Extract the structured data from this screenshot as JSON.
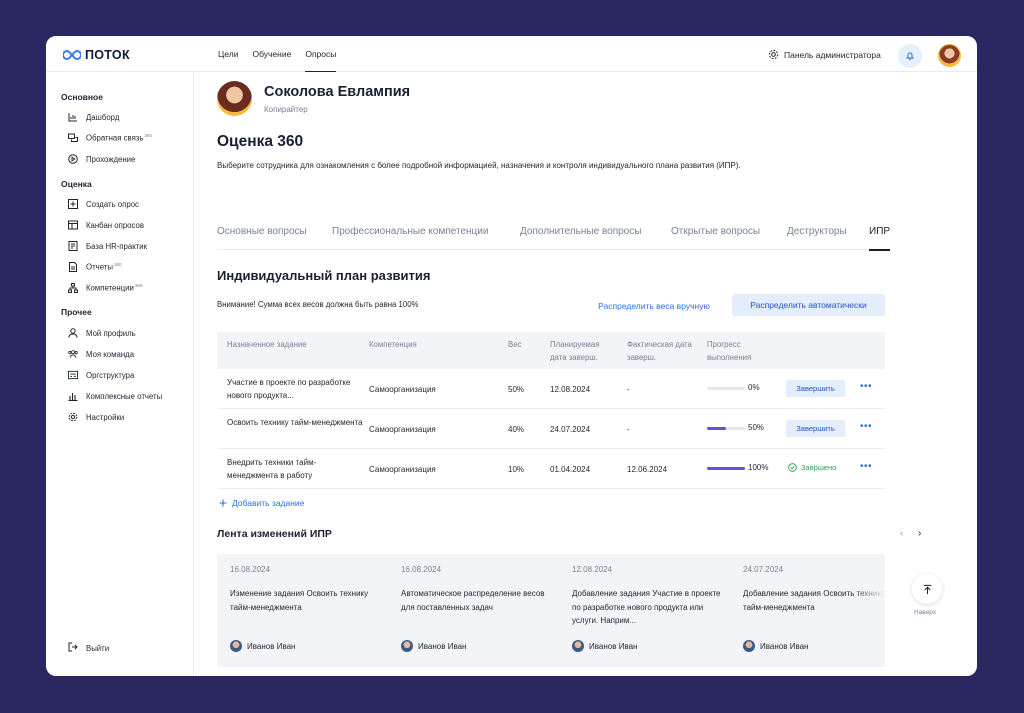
{
  "app": {
    "logo_text": "ПОТОК"
  },
  "topnav": {
    "items": [
      "Цели",
      "Обучение",
      "Опросы"
    ],
    "active": "Опросы"
  },
  "header": {
    "admin_label": "Панель администратора"
  },
  "sidebar": {
    "sections": [
      {
        "title": "Основное",
        "items": [
          {
            "label": "Дашборд",
            "badge": "",
            "icon": "chart-icon"
          },
          {
            "label": "Обратная связь",
            "badge": "360",
            "icon": "chat-icon"
          },
          {
            "label": "Прохождение",
            "badge": "",
            "icon": "play-icon"
          }
        ]
      },
      {
        "title": "Оценка",
        "items": [
          {
            "label": "Создать опрос",
            "badge": "",
            "icon": "plus-square-icon"
          },
          {
            "label": "Канбан опросов",
            "badge": "",
            "icon": "kanban-icon"
          },
          {
            "label": "База HR-практик",
            "badge": "",
            "icon": "book-icon"
          },
          {
            "label": "Отчеты",
            "badge": "360",
            "icon": "report-icon"
          },
          {
            "label": "Компетенции",
            "badge": "360",
            "icon": "tree-icon"
          }
        ]
      },
      {
        "title": "Прочее",
        "items": [
          {
            "label": "Мой профиль",
            "badge": "",
            "icon": "user-icon"
          },
          {
            "label": "Моя команда",
            "badge": "",
            "icon": "team-icon"
          },
          {
            "label": "Оргструктура",
            "badge": "",
            "icon": "org-icon"
          },
          {
            "label": "Комплексные отчеты",
            "badge": "",
            "icon": "bar-chart-icon"
          },
          {
            "label": "Настройки",
            "badge": "",
            "icon": "gear-icon"
          }
        ]
      }
    ],
    "logout_label": "Выйти"
  },
  "person": {
    "name": "Соколова Евлампия",
    "role": "Копирайтер"
  },
  "page": {
    "title": "Оценка 360",
    "description": "Выберите сотрудника для ознакомления с более подробной информацией, назначения и контроля индивидуального плана развития (ИПР)."
  },
  "tabs": [
    "Основные вопросы",
    "Профессиональные компетенции",
    "Дополнительные вопросы",
    "Открытые вопросы",
    "Деструкторы",
    "ИПР"
  ],
  "active_tab": "ИПР",
  "ipr": {
    "title": "Индивидуальный план развития",
    "warning": "Внимание! Сумма всех весов должна быть равна 100%",
    "manual_btn": "Распределить веса вручную",
    "auto_btn": "Распределить автоматически",
    "columns": [
      "Назначенное задание",
      "Компетенция",
      "Вес",
      "Планируемая дата заверш.",
      "Фактическая дата заверш.",
      "Прогресс выполнения"
    ],
    "rows": [
      {
        "task": "Участие в проекте по разработке нового продукта...",
        "competence": "Самоорганизация",
        "weight": "50%",
        "planned": "12.08.2024",
        "actual": "-",
        "progress_label": "0%",
        "progress": 0,
        "action": "Завершить",
        "status": ""
      },
      {
        "task": "Освоить технику тайм-менеджмента",
        "competence": "Самоорганизация",
        "weight": "40%",
        "planned": "24.07.2024",
        "actual": "-",
        "progress_label": "50%",
        "progress": 0.5,
        "action": "Завершить",
        "status": ""
      },
      {
        "task": "Внедрить техники тайм-менеджмента в работу",
        "competence": "Самоорганизация",
        "weight": "10%",
        "planned": "01.04.2024",
        "actual": "12.06.2024",
        "progress_label": "100%",
        "progress": 1,
        "action": "",
        "status": "Завршено"
      }
    ],
    "add_label": "Добавить задание"
  },
  "feed": {
    "title": "Лента изменений ИПР",
    "cards": [
      {
        "date": "16.08.2024",
        "text": "Изменение задания Освоить технику тайм-менеджмента",
        "author": "Иванов Иван"
      },
      {
        "date": "16.08.2024",
        "text": "Автоматическое распределение весов для поставленных задач",
        "author": "Иванов Иван"
      },
      {
        "date": "12.08.2024",
        "text": "Добавление задания Участие в проекте по разработке нового продукта или услуги. Наприм...",
        "author": "Иванов Иван"
      },
      {
        "date": "24.07.2024",
        "text": "Добавление задания Освоить технику тайм-менеджмента",
        "author": "Иванов Иван"
      }
    ]
  },
  "to_top_label": "Наверх",
  "colors": {
    "accent": "#2f6fe4",
    "progress": "#6c4ce0",
    "success": "#2f9e55",
    "frame": "#2a2660"
  }
}
